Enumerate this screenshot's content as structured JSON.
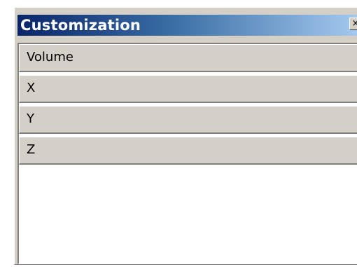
{
  "window": {
    "title": "Customization",
    "close_glyph": "×"
  },
  "list": {
    "items": [
      {
        "label": "Volume"
      },
      {
        "label": "X"
      },
      {
        "label": "Y"
      },
      {
        "label": "Z"
      }
    ]
  },
  "colors": {
    "titlebar_start": "#0a246a",
    "titlebar_end": "#a6caf0",
    "face": "#d4d0c8"
  },
  "icons": {
    "close": "close-icon"
  }
}
